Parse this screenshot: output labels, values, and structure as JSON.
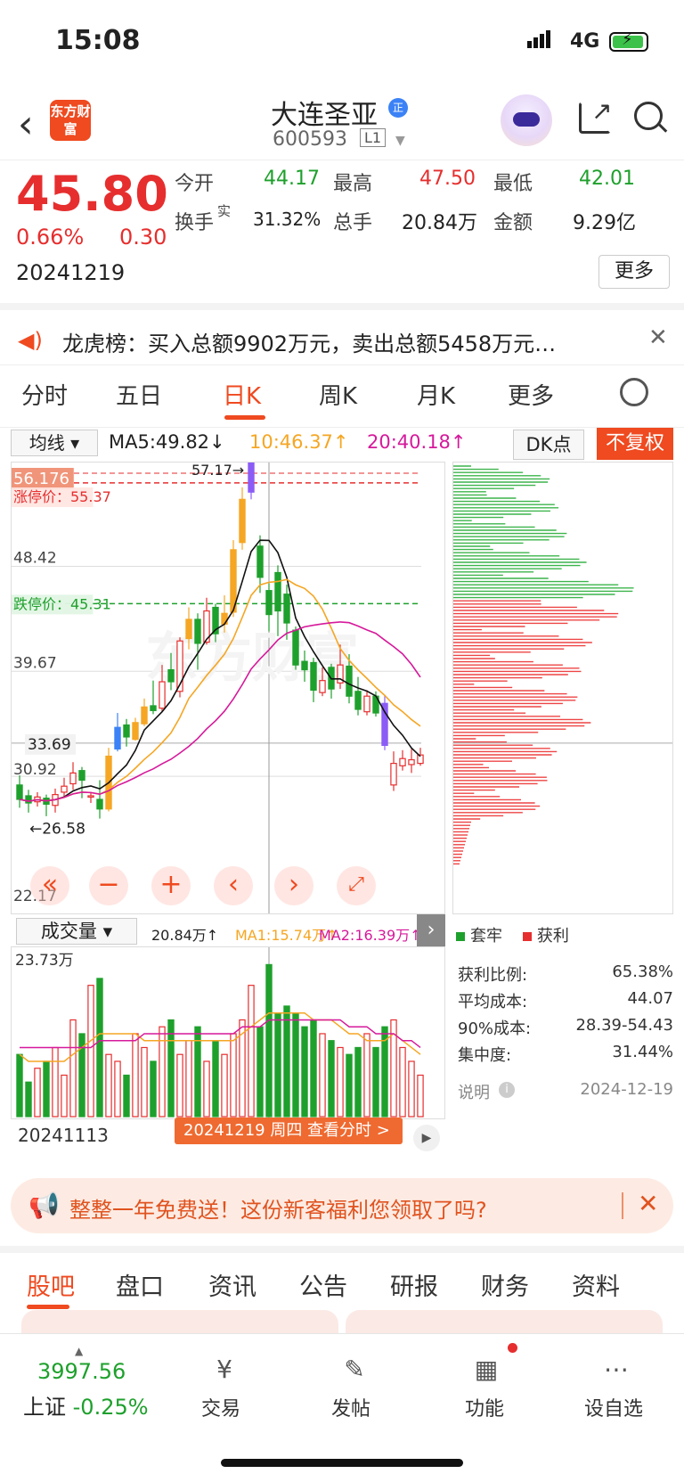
{
  "status_bar": {
    "time": "15:08",
    "network": "4G"
  },
  "header": {
    "brand": "东方财富",
    "stock_name": "大连圣亚",
    "badge": "正",
    "code": "600593",
    "level": "L1"
  },
  "quote": {
    "price": "45.80",
    "change_pct": "0.66%",
    "change": "0.30",
    "date": "20241219",
    "open_label": "今开",
    "open": "44.17",
    "high_label": "最高",
    "high": "47.50",
    "low_label": "最低",
    "low": "42.01",
    "turnover_label": "换手",
    "turnover_sup": "实",
    "turnover": "31.32%",
    "volume_label": "总手",
    "volume": "20.84万",
    "amount_label": "金额",
    "amount": "9.29亿",
    "more": "更多"
  },
  "notice": {
    "text": "龙虎榜：买入总额9902万元，卖出总额5458万元…"
  },
  "tabs": [
    "分时",
    "五日",
    "日K",
    "周K",
    "月K",
    "更多"
  ],
  "chart_toolbar": {
    "indicator": "均线",
    "ma5": "MA5:49.82↓",
    "ma10": "10:46.37↑",
    "ma20": "20:40.18↑",
    "dk": "DK点",
    "adjust": "不复权"
  },
  "chart_labels": {
    "y_top": "56.176",
    "limit_up": "涨停价：55.37",
    "peak": "57.17→",
    "y2": "48.42",
    "limit_down": "跌停价：45.31",
    "y3": "39.67",
    "cur": "33.69",
    "y4": "30.92",
    "low_mark": "←26.58",
    "y_bottom": "22.17"
  },
  "chart_data": {
    "type": "candlestick",
    "y_range": [
      22.17,
      56.176
    ],
    "candles": [
      [
        30.2,
        29.0,
        31.0,
        28.3
      ],
      [
        29.3,
        28.7,
        29.8,
        27.9
      ],
      [
        28.8,
        29.2,
        29.6,
        28.4
      ],
      [
        29.1,
        28.6,
        29.4,
        27.6
      ],
      [
        28.5,
        29.4,
        29.9,
        27.9
      ],
      [
        29.6,
        30.1,
        30.8,
        29.2
      ],
      [
        30.3,
        31.2,
        32.1,
        29.8
      ],
      [
        31.4,
        30.6,
        31.7,
        29.1
      ],
      [
        29.2,
        29.3,
        29.6,
        28.7
      ],
      [
        29.0,
        28.2,
        30.6,
        27.4
      ],
      [
        28.2,
        32.6,
        33.3,
        28.0
      ],
      [
        33.2,
        35.0,
        36.2,
        33.0
      ],
      [
        35.2,
        34.2,
        35.7,
        33.4
      ],
      [
        34.0,
        35.4,
        35.8,
        33.9
      ],
      [
        35.3,
        36.7,
        37.4,
        35.1
      ],
      [
        36.8,
        36.4,
        38.9,
        36.1
      ],
      [
        36.6,
        38.8,
        40.2,
        36.3
      ],
      [
        39.8,
        38.8,
        41.2,
        38.1
      ],
      [
        38.0,
        42.2,
        42.5,
        37.5
      ],
      [
        42.4,
        44.0,
        45.0,
        41.5
      ],
      [
        44.0,
        42.0,
        44.5,
        39.8
      ],
      [
        42.1,
        44.7,
        45.8,
        41.9
      ],
      [
        45.0,
        42.8,
        45.3,
        42.1
      ],
      [
        43.6,
        44.5,
        46.0,
        42.9
      ],
      [
        44.6,
        49.8,
        50.6,
        44.2
      ],
      [
        50.4,
        54.0,
        55.0,
        49.8
      ],
      [
        54.6,
        57.17,
        57.17,
        54.0
      ],
      [
        50.1,
        47.5,
        51.0,
        46.2
      ],
      [
        46.4,
        44.4,
        47.0,
        43.0
      ],
      [
        47.9,
        44.7,
        48.5,
        42.6
      ],
      [
        46.1,
        43.7,
        46.9,
        42.3
      ],
      [
        43.1,
        40.2,
        43.4,
        39.8
      ],
      [
        40.5,
        39.8,
        41.4,
        38.8
      ],
      [
        40.4,
        38.1,
        40.8,
        37.1
      ],
      [
        37.9,
        38.9,
        40.0,
        37.6
      ],
      [
        40.0,
        38.2,
        40.3,
        37.4
      ],
      [
        38.7,
        40.2,
        41.9,
        38.2
      ],
      [
        40.1,
        37.6,
        41.1,
        37.0
      ],
      [
        38.0,
        36.5,
        39.2,
        36.0
      ],
      [
        36.3,
        37.6,
        38.1,
        36.0
      ],
      [
        37.6,
        36.2,
        38.0,
        35.9
      ],
      [
        37.0,
        33.5,
        37.6,
        33.1
      ],
      [
        30.2,
        32.0,
        33.0,
        29.7
      ],
      [
        31.8,
        32.4,
        33.1,
        31.4
      ],
      [
        31.9,
        32.3,
        33.2,
        31.2
      ],
      [
        32.0,
        32.7,
        33.3,
        31.8
      ]
    ],
    "volumes": [
      9,
      5,
      7,
      8,
      10,
      6,
      14,
      12,
      19,
      20,
      9,
      8,
      6,
      12,
      10,
      8,
      13,
      14,
      9,
      11,
      13,
      8,
      11,
      9,
      12,
      14,
      19,
      13,
      22,
      15,
      16,
      15,
      13,
      14,
      12,
      11,
      10,
      9,
      10,
      12,
      10,
      13,
      14,
      10,
      8,
      6
    ],
    "ma_vol_1": [
      9,
      8,
      8,
      8,
      8,
      8,
      9,
      10,
      11,
      12,
      12,
      12,
      12,
      12,
      11,
      11,
      11,
      11,
      11,
      11,
      11,
      11,
      11,
      11,
      11,
      12,
      13,
      14,
      15,
      15,
      15,
      15,
      15,
      14,
      14,
      14,
      13,
      12,
      12,
      11,
      11,
      11,
      12,
      11,
      10,
      9
    ],
    "ma_vol_2": [
      10,
      10,
      10,
      10,
      10,
      10,
      10,
      10,
      10,
      11,
      11,
      11,
      11,
      11,
      12,
      12,
      12,
      12,
      12,
      12,
      12,
      12,
      12,
      12,
      12,
      13,
      13,
      13,
      14,
      14,
      14,
      14,
      14,
      14,
      14,
      14,
      14,
      13,
      13,
      13,
      12,
      12,
      12,
      11,
      11,
      10
    ],
    "volume_y_max_label": "23.73万"
  },
  "volume_header": {
    "selector": "成交量",
    "value": "20.84万↑",
    "ma1": "MA1:15.74万↑",
    "ma2": "MA2:16.39万↑"
  },
  "volume_footer": {
    "start_date": "20241113",
    "banner": "20241219 周四 查看分时 >"
  },
  "chip_stats": {
    "legend_trapped": "套牢",
    "legend_profit": "获利",
    "rows": [
      {
        "label": "获利比例:",
        "value": "65.38%"
      },
      {
        "label": "平均成本:",
        "value": "44.07"
      },
      {
        "label": "90%成本:",
        "value": "28.39-54.43"
      },
      {
        "label": "集中度:",
        "value": "31.44%"
      }
    ],
    "note": "说明",
    "date": "2024-12-19"
  },
  "promo": {
    "text": "整整一年免费送！这份新客福利您领取了吗?"
  },
  "bottom_tabs": [
    "股吧",
    "盘口",
    "资讯",
    "公告",
    "研报",
    "财务",
    "资料"
  ],
  "bottom_nav": {
    "index_value": "3997.56",
    "index_name": "上证",
    "index_change": "-0.25%",
    "items": [
      "交易",
      "发帖",
      "功能",
      "设自选"
    ]
  },
  "colors": {
    "accent": "#ef4a20",
    "up": "#e62e2e",
    "down": "#1ea02c",
    "ma10": "#f5a623",
    "ma20": "#d6199b"
  }
}
